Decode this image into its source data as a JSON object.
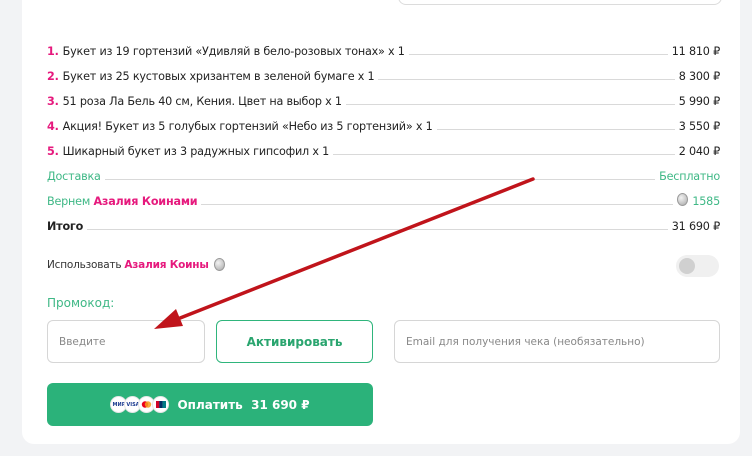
{
  "items": [
    {
      "num": "1.",
      "name": "Букет из 19 гортензий «Удивляй в бело-розовых тонах» x 1",
      "price": "11 810 ₽"
    },
    {
      "num": "2.",
      "name": "Букет из 25 кустовых хризантем в зеленой бумаге x 1",
      "price": "8 300 ₽"
    },
    {
      "num": "3.",
      "name": "51 роза Ла Бель 40 см, Кения. Цвет на выбор x 1",
      "price": "5 990 ₽"
    },
    {
      "num": "4.",
      "name": "Акция! Букет из 5 голубых гортензий «Небо из 5 гортензий» x 1",
      "price": "3 550 ₽"
    },
    {
      "num": "5.",
      "name": "Шикарный букет из 3 радужных гипсофил x 1",
      "price": "2 040 ₽"
    }
  ],
  "delivery": {
    "label": "Доставка",
    "value": "Бесплатно"
  },
  "cashback": {
    "prefix": "Вернем ",
    "coins_name": "Азалия Коинами",
    "value": "1585"
  },
  "total": {
    "label": "Итого",
    "value": "31 690 ₽"
  },
  "use_coins": {
    "prefix": "Использовать ",
    "coins_name": "Азалия Коины",
    "enabled": false
  },
  "promo": {
    "label": "Промокод:",
    "placeholder": "Введите",
    "activate_label": "Активировать"
  },
  "email": {
    "placeholder": "Email для получения чека (необязательно)"
  },
  "pay": {
    "label": "Оплатить  31 690 ₽",
    "cards": [
      "МИР",
      "VISA",
      "MC",
      "UP"
    ]
  },
  "colors": {
    "accent_green": "#2bb27a",
    "accent_pink": "#e6197d",
    "arrow_red": "#c0141b"
  }
}
